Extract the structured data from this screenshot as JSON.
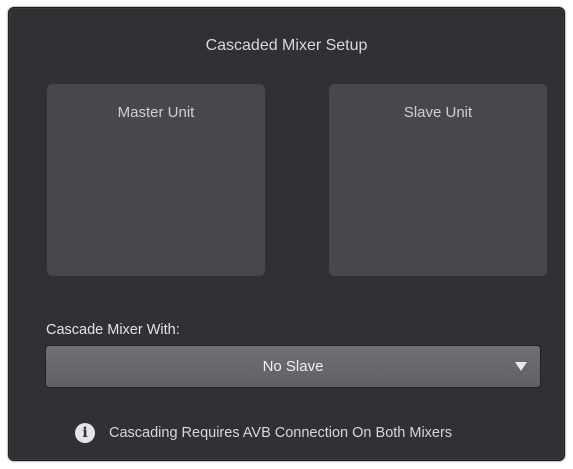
{
  "dialog": {
    "title": "Cascaded Mixer Setup",
    "master_unit_label": "Master Unit",
    "slave_unit_label": "Slave Unit",
    "cascade_label": "Cascade Mixer With:",
    "cascade_select_value": "No Slave",
    "notice_icon": "info-icon",
    "notice_icon_glyph": "i",
    "notice_text": "Cascading Requires AVB Connection On Both Mixers"
  },
  "colors": {
    "panel_bg": "#2f3135",
    "unit_box_bg": "#47484b",
    "dropdown_bg": "#65676b",
    "text": "#d8d9db"
  }
}
